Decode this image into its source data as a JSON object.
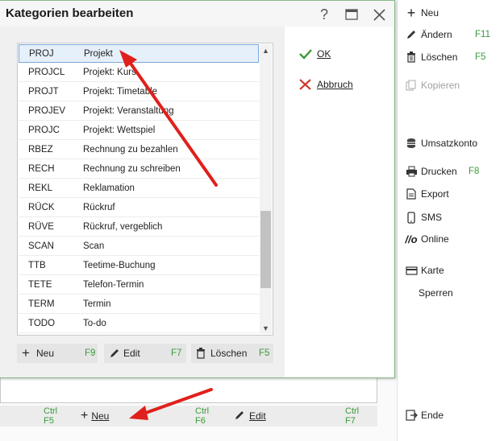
{
  "dialog": {
    "title": "Kategorien bearbeiten",
    "help_icon": "question-icon",
    "ok_label": "OK",
    "cancel_label": "Abbruch",
    "categories": [
      {
        "code": "PROJ",
        "name": "Projekt"
      },
      {
        "code": "PROJCL",
        "name": "Projekt: Kurs"
      },
      {
        "code": "PROJT",
        "name": "Projekt: Timetable"
      },
      {
        "code": "PROJEV",
        "name": "Projekt: Veranstaltung"
      },
      {
        "code": "PROJC",
        "name": "Projekt: Wettspiel"
      },
      {
        "code": "RBEZ",
        "name": "Rechnung zu bezahlen"
      },
      {
        "code": "RECH",
        "name": "Rechnung zu schreiben"
      },
      {
        "code": "REKL",
        "name": "Reklamation"
      },
      {
        "code": "RÜCK",
        "name": "Rückruf"
      },
      {
        "code": "RÜVE",
        "name": "Rückruf, vergeblich"
      },
      {
        "code": "SCAN",
        "name": "Scan"
      },
      {
        "code": "TTB",
        "name": "Teetime-Buchung"
      },
      {
        "code": "TETE",
        "name": "Telefon-Termin"
      },
      {
        "code": "TERM",
        "name": "Termin"
      },
      {
        "code": "TODO",
        "name": "To-do"
      }
    ],
    "list_buttons": {
      "new_label": "Neu",
      "new_shortcut": "F9",
      "edit_label": "Edit",
      "edit_shortcut": "F7",
      "delete_label": "Löschen",
      "delete_shortcut": "F5"
    }
  },
  "bottom_bar": {
    "shortcut1": "Ctrl F5",
    "new_label": "Neu",
    "shortcut2": "Ctrl F6",
    "edit_label": "Edit",
    "shortcut3": "Ctrl F7"
  },
  "sidebar": {
    "new_label": "Neu",
    "change_label": "Ändern",
    "change_shortcut": "F11",
    "delete_label": "Löschen",
    "delete_shortcut": "F5",
    "copy_label": "Kopieren",
    "account_label": "Umsatzkonto",
    "print_label": "Drucken",
    "print_shortcut": "F8",
    "export_label": "Export",
    "sms_label": "SMS",
    "online_label": "Online",
    "card_label": "Karte",
    "lock_label": "Sperren",
    "end_label": "Ende"
  },
  "colors": {
    "shortcut_green": "#3a9a3a",
    "arrow_red": "#e0201c",
    "selection_border": "#7aa7d9"
  }
}
